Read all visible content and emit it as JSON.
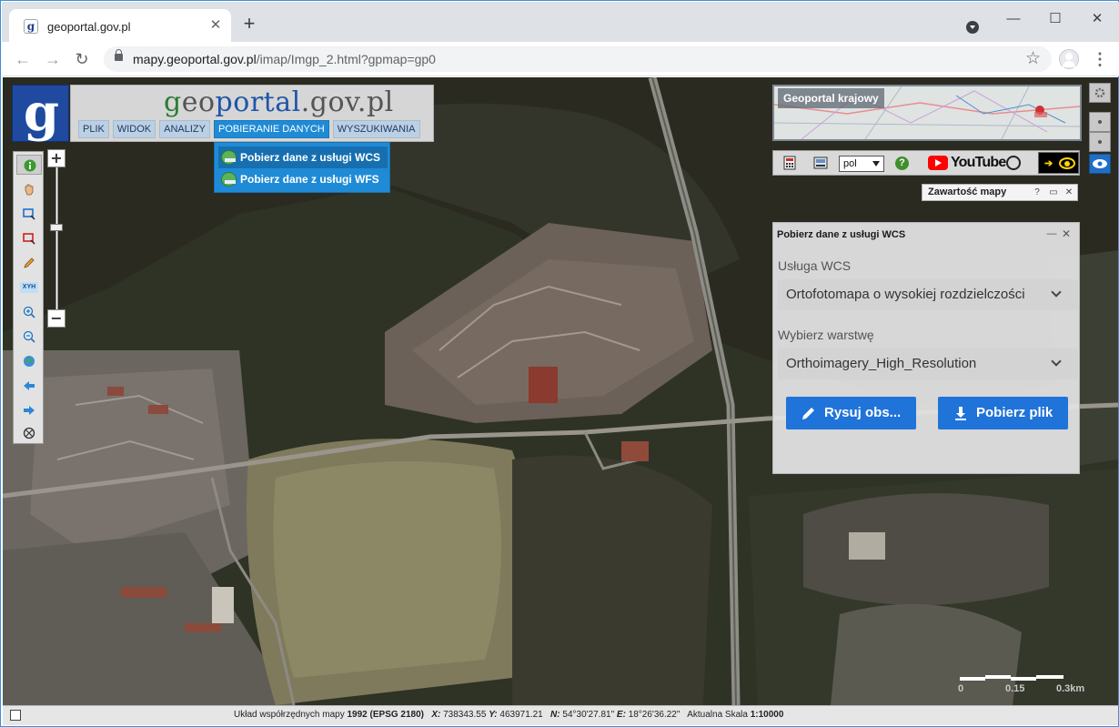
{
  "browser": {
    "tab_title": "geoportal.gov.pl",
    "tab_close": "✕",
    "new_tab": "+",
    "url_domain": "mapy.geoportal.gov.pl",
    "url_path": "/imap/Imgp_2.html?gpmap=gp0",
    "window_minimize": "—",
    "window_maximize": "☐",
    "window_close": "✕",
    "nav_back": "←",
    "nav_forward": "→",
    "nav_reload": "↻",
    "bookmark_star": "☆",
    "menu_dots": "⋮"
  },
  "header": {
    "logo_letter": "g",
    "title_part1": "g",
    "title_part2": "eo",
    "title_part3": "p",
    "title_part4": "o",
    "title_part5": "rtal",
    "title_part6": ".gov.pl",
    "menu": [
      {
        "label": "PLIK",
        "active": false
      },
      {
        "label": "WIDOK",
        "active": false
      },
      {
        "label": "ANALIZY",
        "active": false
      },
      {
        "label": "POBIERANIE DANYCH",
        "active": true
      },
      {
        "label": "WYSZUKIWANIA",
        "active": false
      }
    ]
  },
  "dropdown": {
    "items": [
      {
        "label": "Pobierz dane z usługi WCS",
        "icon": "wcs-icon"
      },
      {
        "label": "Pobierz dane z usługi WFS",
        "icon": "wfs-icon"
      }
    ]
  },
  "left_toolbar": {
    "tools": [
      "info-icon",
      "pan-hand-icon",
      "zoom-box-icon",
      "select-box-icon",
      "measure-pencil-icon",
      "xyh-icon",
      "zoom-in-icon",
      "zoom-out-icon",
      "full-extent-globe-icon",
      "previous-extent-icon",
      "next-extent-icon",
      "clear-icon"
    ],
    "xyh_label": "XYH",
    "zoom_in": "+",
    "zoom_out": "−",
    "zoom_level": 0.42
  },
  "overview": {
    "title": "Geoportal krajowy"
  },
  "icon_strip": {
    "language": "pol",
    "help": "?",
    "youtube": "YouTube"
  },
  "content_tab": {
    "label": "Zawartość mapy",
    "help": "?",
    "restore": "▭",
    "close": "✕"
  },
  "wcs_panel": {
    "title": "Pobierz dane z usługi WCS",
    "minimize": "—",
    "close": "✕",
    "service_label": "Usługa WCS",
    "service_value": "Ortofotomapa o wysokiej rozdzielczości",
    "layer_label": "Wybierz warstwę",
    "layer_value": "Orthoimagery_High_Resolution",
    "draw_button": "Rysuj obs...",
    "download_button": "Pobierz plik"
  },
  "scale_bar": {
    "labels": [
      "0",
      "0.15",
      "0.3km"
    ]
  },
  "status": {
    "crs_label": "Układ współrzędnych mapy",
    "crs_value": "1992 (EPSG 2180)",
    "x_label": "X:",
    "x_value": "738343.55",
    "y_label": "Y:",
    "y_value": "463971.21",
    "n_label": "N:",
    "n_value": "54°30'27.81\"",
    "e_label": "E:",
    "e_value": "18°26'36.22\"",
    "scale_label": "Aktualna Skala",
    "scale_value": "1:10000"
  },
  "colors": {
    "menu_active": "#1f8bd6",
    "button_blue": "#1f73d9",
    "panel_bg": "#e2e2e2",
    "logo_blue": "#1f4aa0"
  }
}
